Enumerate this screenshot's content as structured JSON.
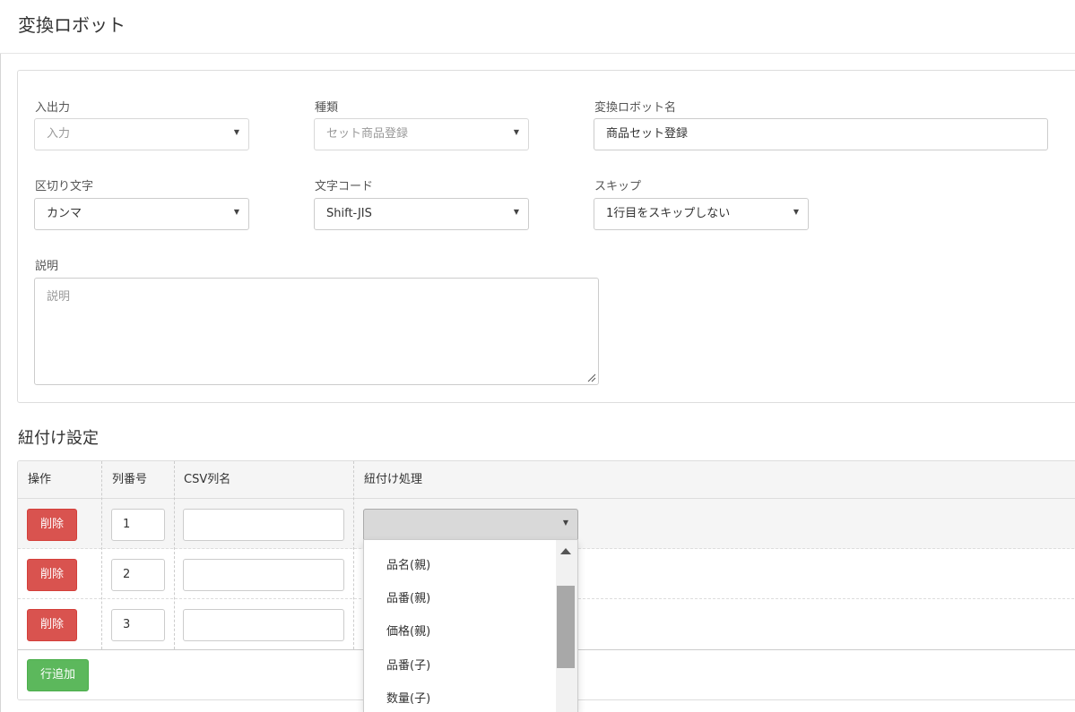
{
  "page": {
    "title": "変換ロボット"
  },
  "form": {
    "io": {
      "label": "入出力",
      "value": "入力"
    },
    "kind": {
      "label": "種類",
      "value": "セット商品登録"
    },
    "robot_name": {
      "label": "変換ロボット名",
      "value": "商品セット登録"
    },
    "delimiter": {
      "label": "区切り文字",
      "value": "カンマ"
    },
    "charset": {
      "label": "文字コード",
      "value": "Shift-JIS"
    },
    "skip": {
      "label": "スキップ",
      "value": "1行目をスキップしない"
    },
    "description": {
      "label": "説明",
      "placeholder": "説明"
    }
  },
  "mapping": {
    "title": "紐付け設定",
    "columns": [
      "操作",
      "列番号",
      "CSV列名",
      "紐付け処理"
    ],
    "rows": [
      {
        "delete_label": "削除",
        "number": "1",
        "csv_name": "",
        "mapping": ""
      },
      {
        "delete_label": "削除",
        "number": "2",
        "csv_name": "",
        "mapping": ""
      },
      {
        "delete_label": "削除",
        "number": "3",
        "csv_name": "",
        "mapping": ""
      }
    ],
    "add_label": "行追加"
  },
  "dropdown": {
    "options": [
      "品名(親)",
      "品番(親)",
      "価格(親)",
      "品番(子)",
      "数量(子)"
    ]
  },
  "colors": {
    "danger": "#d9534f",
    "success": "#5cb85c"
  }
}
